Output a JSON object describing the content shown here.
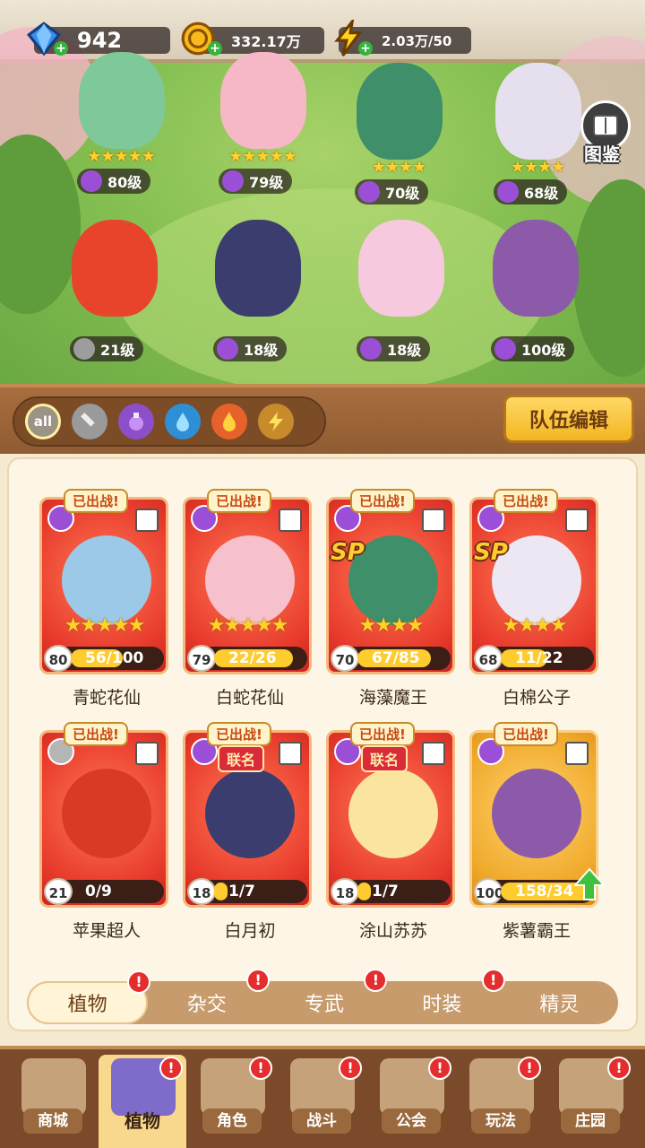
{
  "resources": {
    "gems": "942",
    "coins": "332.17万",
    "energy": "2.03万/50"
  },
  "handbook_label": "图鉴",
  "field_slots": [
    {
      "level": "80级",
      "stars": "★★★★★",
      "color": "#7fc89a",
      "elem_color": "#9b4fd6"
    },
    {
      "level": "79级",
      "stars": "★★★★★",
      "color": "#f6b8c6",
      "elem_color": "#9b4fd6"
    },
    {
      "level": "70级",
      "stars": "★★★★",
      "color": "#3e8f6a",
      "elem_color": "#9b4fd6"
    },
    {
      "level": "68级",
      "stars": "★★★★",
      "color": "#e6e0ee",
      "elem_color": "#9b4fd6"
    },
    {
      "level": "21级",
      "stars": "",
      "color": "#e8442c",
      "elem_color": "#9d9d9d"
    },
    {
      "level": "18级",
      "stars": "",
      "color": "#3a3d6e",
      "elem_color": "#9b4fd6"
    },
    {
      "level": "18级",
      "stars": "",
      "color": "#f6c9df",
      "elem_color": "#9b4fd6"
    },
    {
      "level": "100级",
      "stars": "",
      "color": "#8c5aa8",
      "elem_color": "#9b4fd6"
    }
  ],
  "filters": {
    "all_label": "all",
    "team_edit": "队伍编辑"
  },
  "cards": [
    {
      "name": "青蛇花仙",
      "level": "80",
      "progress": "56/100",
      "fill": 0.56,
      "stars": "★★★★★",
      "deployed": "已出战!",
      "art": "#9cc9e8",
      "sp": "",
      "collab": ""
    },
    {
      "name": "白蛇花仙",
      "level": "79",
      "progress": "22/26",
      "fill": 0.85,
      "stars": "★★★★★",
      "deployed": "已出战!",
      "art": "#f6c0cc",
      "sp": "",
      "collab": ""
    },
    {
      "name": "海藻魔王",
      "level": "70",
      "progress": "67/85",
      "fill": 0.79,
      "stars": "★★★★",
      "deployed": "已出战!",
      "art": "#3e8f6a",
      "sp": "SP",
      "collab": ""
    },
    {
      "name": "白棉公子",
      "level": "68",
      "progress": "11/22",
      "fill": 0.5,
      "stars": "★★★★",
      "deployed": "已出战!",
      "art": "#ede7f4",
      "sp": "SP",
      "collab": ""
    },
    {
      "name": "苹果超人",
      "level": "21",
      "progress": "0/9",
      "fill": 0.0,
      "stars": "",
      "deployed": "已出战!",
      "art": "#d93a25",
      "sp": "",
      "collab": ""
    },
    {
      "name": "白月初",
      "level": "18",
      "progress": "1/7",
      "fill": 0.14,
      "stars": "",
      "deployed": "已出战!",
      "art": "#3a3d6e",
      "sp": "",
      "collab": "联名"
    },
    {
      "name": "涂山苏苏",
      "level": "18",
      "progress": "1/7",
      "fill": 0.14,
      "stars": "",
      "deployed": "已出战!",
      "art": "#fbe3a0",
      "sp": "",
      "collab": "联名"
    },
    {
      "name": "紫薯霸王",
      "level": "100",
      "progress": "158/34",
      "fill": 1.0,
      "stars": "",
      "deployed": "已出战!",
      "art": "#8c5aa8",
      "sp": "",
      "collab": ""
    }
  ],
  "subtabs": [
    "植物",
    "杂交",
    "专武",
    "时装",
    "精灵"
  ],
  "bottom_nav": [
    "商城",
    "植物",
    "角色",
    "战斗",
    "公会",
    "玩法",
    "庄园"
  ],
  "alert_mark": "!"
}
